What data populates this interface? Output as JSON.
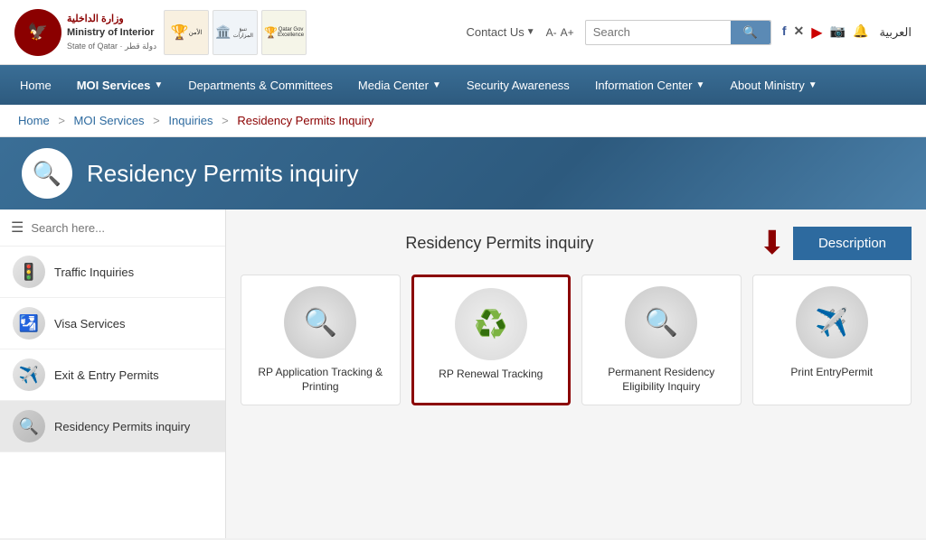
{
  "header": {
    "logo_text": "وزارة الداخلية\nMinistry of Interior\nState of Qatar",
    "contact_label": "Contact Us",
    "font_small": "A-",
    "font_large": "A+",
    "search_placeholder": "Search",
    "search_button": "Search",
    "arabic_label": "العربية"
  },
  "nav": {
    "items": [
      {
        "label": "Home",
        "has_dropdown": false
      },
      {
        "label": "MOI Services",
        "has_dropdown": true
      },
      {
        "label": "Departments & Committees",
        "has_dropdown": false
      },
      {
        "label": "Media Center",
        "has_dropdown": true
      },
      {
        "label": "Security Awareness",
        "has_dropdown": false
      },
      {
        "label": "Information Center",
        "has_dropdown": true
      },
      {
        "label": "About Ministry",
        "has_dropdown": true
      }
    ]
  },
  "breadcrumb": {
    "items": [
      {
        "label": "Home",
        "link": true
      },
      {
        "label": "MOI Services",
        "link": true
      },
      {
        "label": "Inquiries",
        "link": true
      },
      {
        "label": "Residency Permits Inquiry",
        "link": false
      }
    ]
  },
  "banner": {
    "title": "Residency Permits inquiry",
    "icon": "🔍"
  },
  "sidebar": {
    "search_placeholder": "Search here...",
    "items": [
      {
        "label": "Traffic Inquiries",
        "icon": "🚦"
      },
      {
        "label": "Visa Services",
        "icon": "🛂"
      },
      {
        "label": "Exit & Entry Permits",
        "icon": "✈️"
      },
      {
        "label": "Residency Permits inquiry",
        "icon": "🔍",
        "active": true
      }
    ]
  },
  "content": {
    "section_title": "Residency Permits inquiry",
    "description_label": "Description",
    "cards": [
      {
        "label": "RP Application Tracking & Printing",
        "icon": "🔍",
        "selected": false
      },
      {
        "label": "RP Renewal Tracking",
        "icon": "♻️",
        "selected": true
      },
      {
        "label": "Permanent Residency Eligibility Inquiry",
        "icon": "🔍",
        "selected": false
      },
      {
        "label": "Print EntryPermit",
        "icon": "✈️",
        "selected": false
      }
    ]
  },
  "social": {
    "facebook": "f",
    "twitter": "✕",
    "youtube": "▶",
    "instagram": "📷",
    "notification": "🔔"
  }
}
